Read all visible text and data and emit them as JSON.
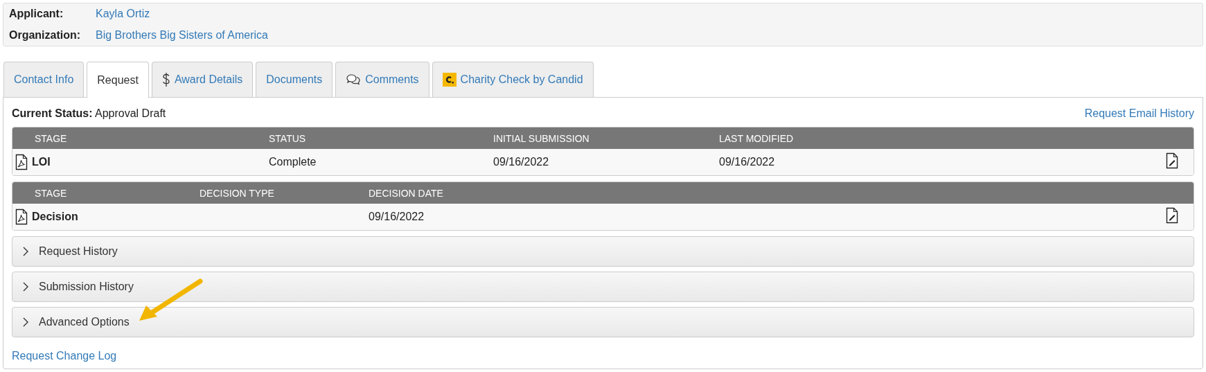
{
  "header": {
    "fields": [
      {
        "label": "Applicant:",
        "value": "Kayla Ortiz"
      },
      {
        "label": "Organization:",
        "value": "Big Brothers Big Sisters of America"
      }
    ]
  },
  "tabs": [
    {
      "label": "Contact Info",
      "kind": "plain",
      "selected": false
    },
    {
      "label": "Request",
      "kind": "plain",
      "selected": true
    },
    {
      "label": "Award Details",
      "kind": "dollar",
      "selected": false
    },
    {
      "label": "Documents",
      "kind": "plain",
      "selected": false
    },
    {
      "label": "Comments",
      "kind": "comments",
      "selected": false
    },
    {
      "label": "Charity Check by Candid",
      "kind": "candid",
      "selected": false
    }
  ],
  "panel": {
    "status_label": "Current Status:",
    "status_value": "Approval Draft",
    "email_history_link": "Request Email History",
    "tables": [
      {
        "columns": [
          {
            "header": "STAGE",
            "value": "LOI"
          },
          {
            "header": "STATUS",
            "value": "Complete"
          },
          {
            "header": "INITIAL SUBMISSION",
            "value": "09/16/2022"
          },
          {
            "header": "LAST MODIFIED",
            "value": "09/16/2022"
          }
        ]
      },
      {
        "columns": [
          {
            "header": "STAGE",
            "value": "Decision"
          },
          {
            "header": "DECISION TYPE"
          },
          {
            "header": "DECISION DATE",
            "value": "09/16/2022"
          }
        ]
      }
    ],
    "sections": [
      {
        "title": "Request History",
        "expanded": false
      },
      {
        "title": "Submission History",
        "expanded": false
      },
      {
        "title": "Advanced Options",
        "expanded": false
      }
    ],
    "change_log_link": "Request Change Log"
  }
}
